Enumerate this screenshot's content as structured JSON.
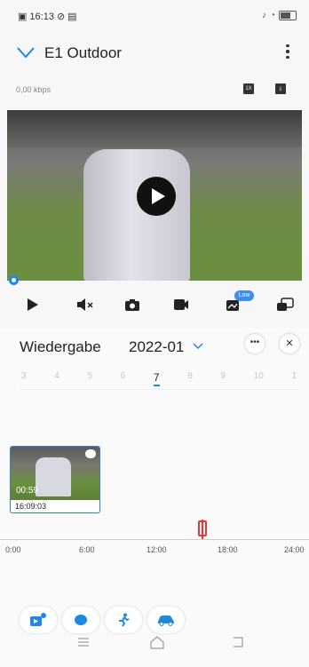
{
  "status_bar": {
    "time": "16:13"
  },
  "header": {
    "title": "E1 Outdoor"
  },
  "stream": {
    "speed": "0,00 kbps"
  },
  "controls": {
    "low_badge": "Low"
  },
  "playback": {
    "title": "Wiedergabe",
    "date": "2022-01",
    "days": [
      "3",
      "4",
      "5",
      "6",
      "7",
      "8",
      "9",
      "10",
      "1"
    ],
    "selected_day": "7"
  },
  "clip": {
    "duration": "00:59",
    "start_time": "16:09:03"
  },
  "timeline": {
    "ticks": [
      "0:00",
      "6:00",
      "12:00",
      "18:00",
      "24:00"
    ]
  },
  "colors": {
    "accent": "#1e88e5",
    "cursor": "#e53935"
  },
  "icons": [
    "play-icon",
    "mute-icon",
    "camera-icon",
    "record-icon",
    "quality-icon",
    "multi-view-icon",
    "more-icon",
    "close-icon",
    "motion-icon",
    "person-icon",
    "vehicle-icon",
    "event-icon"
  ]
}
